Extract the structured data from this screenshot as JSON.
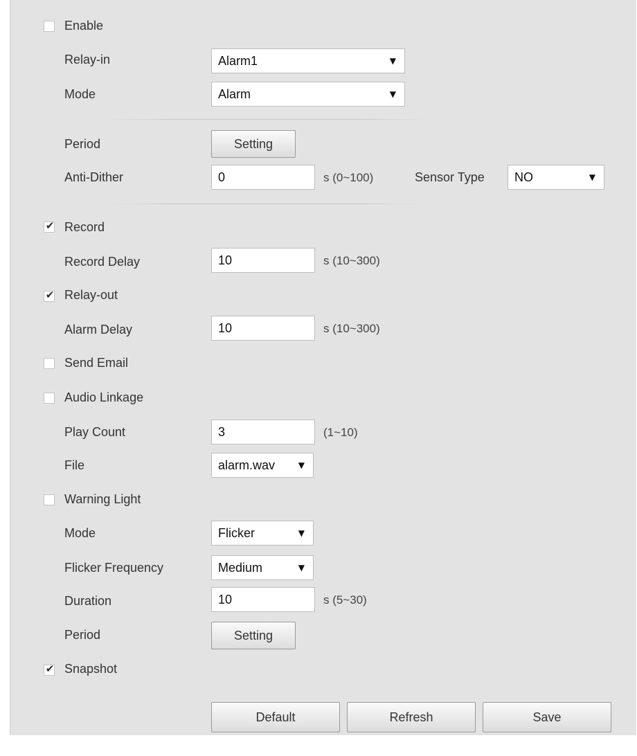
{
  "enable": {
    "label": "Enable",
    "checked": false
  },
  "relay_in": {
    "label": "Relay-in",
    "value": "Alarm1"
  },
  "mode": {
    "label": "Mode",
    "value": "Alarm"
  },
  "period": {
    "label": "Period",
    "button": "Setting"
  },
  "anti_dither": {
    "label": "Anti-Dither",
    "value": "0",
    "hint": "s (0~100)"
  },
  "sensor_type": {
    "label": "Sensor Type",
    "value": "NO"
  },
  "record": {
    "label": "Record",
    "checked": true
  },
  "record_delay": {
    "label": "Record Delay",
    "value": "10",
    "hint": "s (10~300)"
  },
  "relay_out": {
    "label": "Relay-out",
    "checked": true
  },
  "alarm_delay": {
    "label": "Alarm Delay",
    "value": "10",
    "hint": "s (10~300)"
  },
  "send_email": {
    "label": "Send Email",
    "checked": false
  },
  "audio_linkage": {
    "label": "Audio Linkage",
    "checked": false
  },
  "play_count": {
    "label": "Play Count",
    "value": "3",
    "hint": "(1~10)"
  },
  "file": {
    "label": "File",
    "value": "alarm.wav"
  },
  "warning_light": {
    "label": "Warning Light",
    "checked": false
  },
  "wl_mode": {
    "label": "Mode",
    "value": "Flicker"
  },
  "flicker_frequency": {
    "label": "Flicker Frequency",
    "value": "Medium"
  },
  "duration": {
    "label": "Duration",
    "value": "10",
    "hint": "s (5~30)"
  },
  "wl_period": {
    "label": "Period",
    "button": "Setting"
  },
  "snapshot": {
    "label": "Snapshot",
    "checked": true
  },
  "actions": {
    "default": "Default",
    "refresh": "Refresh",
    "save": "Save"
  },
  "glyphs": {
    "check": "✔",
    "dropdown": "▼"
  }
}
